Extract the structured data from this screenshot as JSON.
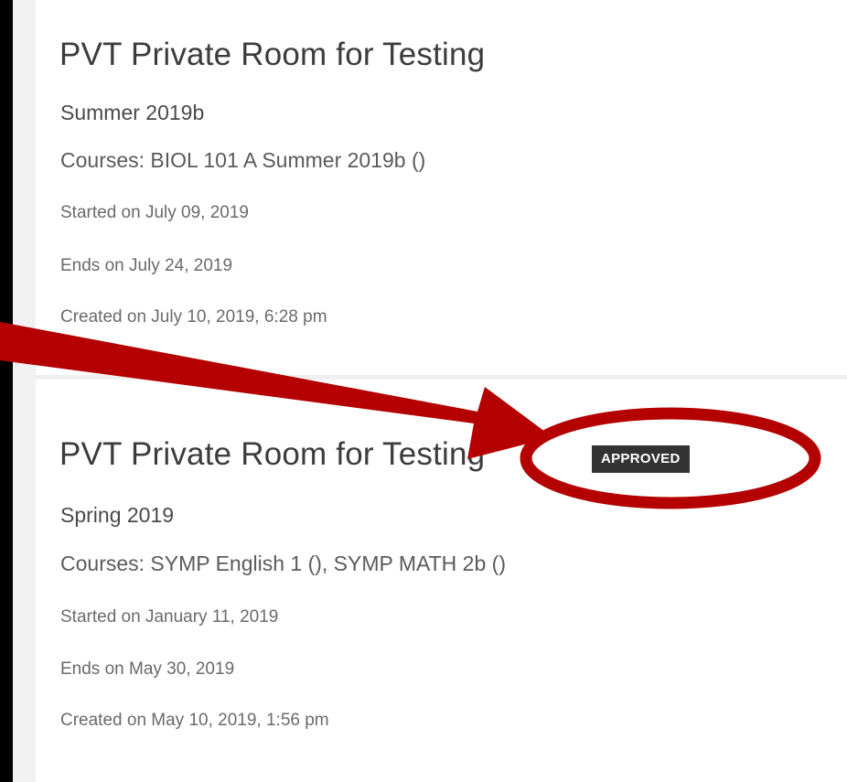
{
  "rooms": [
    {
      "title": "PVT Private Room for Testing",
      "term": "Summer 2019b",
      "courses": "Courses: BIOL 101 A Summer 2019b ()",
      "started": "Started on July 09, 2019",
      "ends": "Ends on July 24, 2019",
      "created": "Created on July 10, 2019, 6:28 pm"
    },
    {
      "title": "PVT Private Room for Testing",
      "status": "APPROVED",
      "term": "Spring 2019",
      "courses": "Courses: SYMP English 1 (), SYMP MATH 2b ()",
      "started": "Started on January 11, 2019",
      "ends": "Ends on May 30, 2019",
      "created": "Created on May 10, 2019, 1:56 pm"
    }
  ],
  "annotation": {
    "color": "#b50000",
    "arrow_icon": "arrow-icon",
    "highlight_icon": "ellipse-highlight-icon"
  }
}
